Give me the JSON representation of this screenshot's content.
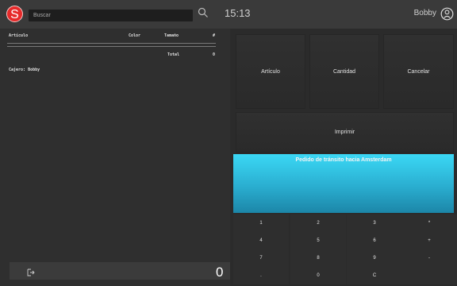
{
  "header": {
    "logo_letter": "S",
    "search_placeholder": "Buscar",
    "time": "15:13",
    "username": "Bobby"
  },
  "order": {
    "columns": {
      "item": "Artículo",
      "color": "Color",
      "size": "Tamaño",
      "count": "#"
    },
    "total_label": "Total",
    "total_count": "0",
    "cashier_line": "Cajero: Bobby",
    "grand_total": "0"
  },
  "actions": {
    "item_label": "Artículo",
    "quantity_label": "Cantidad",
    "cancel_label": "Cancelar",
    "print_label": "Imprimir"
  },
  "transit": {
    "title": "Pedido de tránsito hacia Amsterdam"
  },
  "keypad": {
    "row1": [
      "1",
      "2",
      "3",
      "*"
    ],
    "row2": [
      "4",
      "5",
      "6",
      "+"
    ],
    "row3": [
      "7",
      "8",
      "9",
      "-"
    ],
    "row4": [
      ".",
      "0",
      "C",
      ""
    ]
  },
  "colors": {
    "accent": "#e62a2a",
    "transit_top": "#3bd8f5",
    "transit_bottom": "#1c86a8"
  }
}
